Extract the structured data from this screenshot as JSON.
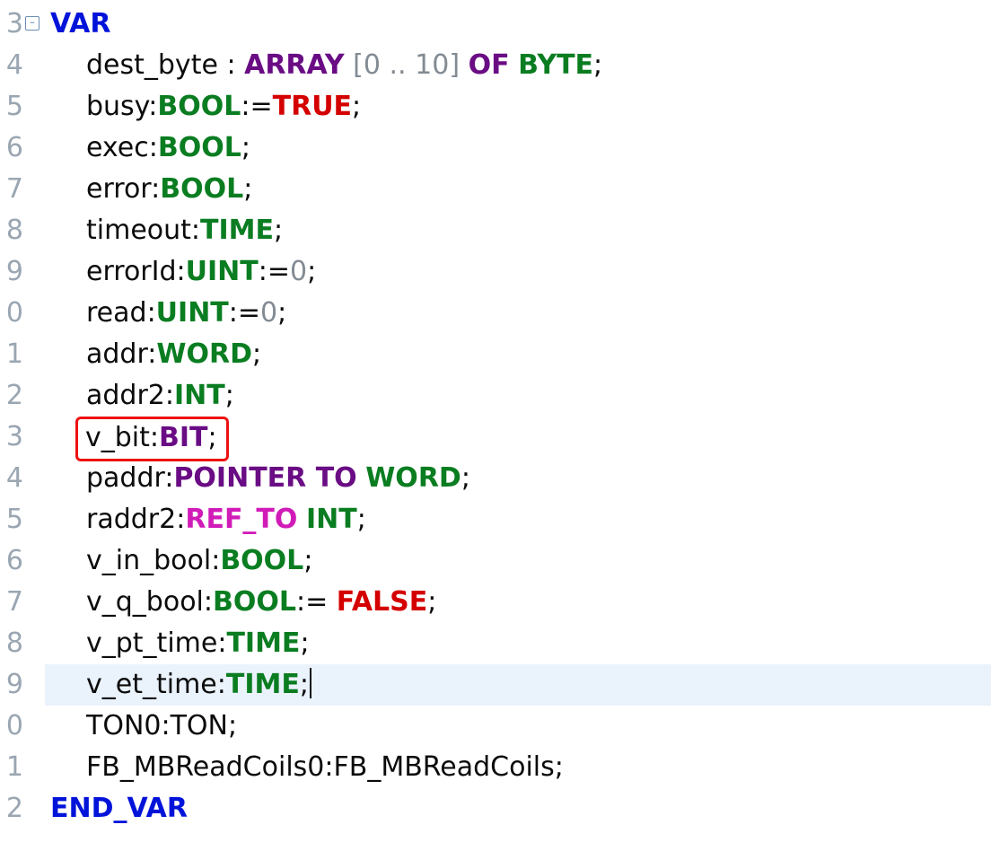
{
  "gutter": [
    "3",
    "4",
    "5",
    "6",
    "7",
    "8",
    "9",
    "0",
    "1",
    "2",
    "3",
    "4",
    "5",
    "6",
    "7",
    "8",
    "9",
    "0",
    "1",
    "2"
  ],
  "kw": {
    "var": "VAR",
    "end_var": "END_VAR",
    "array": "ARRAY",
    "of": "OF",
    "pointer_to": "POINTER TO",
    "ref_to": "REF_TO"
  },
  "ty": {
    "byte": "BYTE",
    "bool": "BOOL",
    "time": "TIME",
    "uint": "UINT",
    "word": "WORD",
    "int": "INT",
    "bit": "BIT"
  },
  "lit": {
    "true": "TRUE",
    "false": "FALSE",
    "zero": "0",
    "ten": "10",
    "rng_l": "[",
    "rng_r": "]",
    "dd": "..",
    "sp": " "
  },
  "names": {
    "dest_byte": "dest_byte",
    "busy": "busy",
    "exec": "exec",
    "error": "error",
    "timeout": "timeout",
    "errorId": "errorId",
    "read": "read",
    "addr": "addr",
    "addr2": "addr2",
    "v_bit": "v_bit",
    "paddr": "paddr",
    "raddr2": "raddr2",
    "v_in_bool": "v_in_bool",
    "v_q_bool": "v_q_bool",
    "v_pt_time": "v_pt_time",
    "v_et_time": "v_et_time",
    "ton0": "TON0",
    "ton_ty": "TON",
    "fb0": "FB_MBReadCoils0",
    "fb_ty": "FB_MBReadCoils"
  },
  "p": {
    "colon": ":",
    "colon_sp": " : ",
    "assign": ":=",
    "assign_sp": ":= ",
    "semi": ";"
  }
}
